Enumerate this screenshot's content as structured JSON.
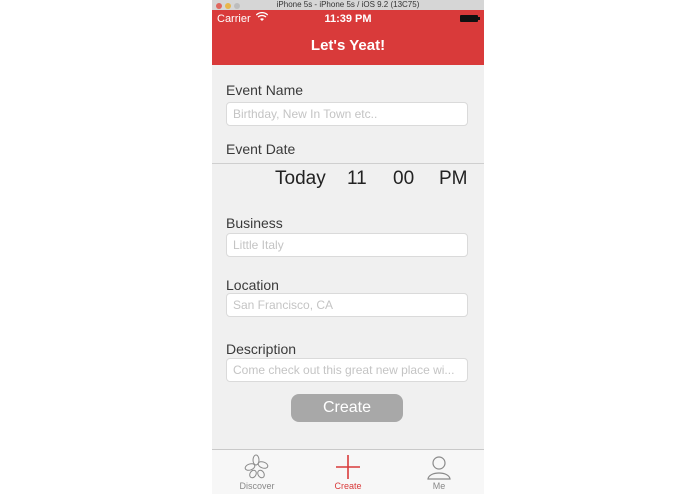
{
  "simulator": {
    "title": "iPhone 5s - iPhone 5s / iOS 9.2 (13C75)"
  },
  "status_bar": {
    "carrier": "Carrier",
    "time": "11:39 PM"
  },
  "nav": {
    "title": "Let's Yeat!"
  },
  "form": {
    "event_name": {
      "label": "Event Name",
      "placeholder": "Birthday, New In Town etc.."
    },
    "event_date": {
      "label": "Event Date",
      "picker": {
        "day": "Today",
        "hour": "11",
        "minute": "00",
        "ampm": "PM"
      }
    },
    "business": {
      "label": "Business",
      "placeholder": "Little Italy"
    },
    "location": {
      "label": "Location",
      "placeholder": "San Francisco, CA"
    },
    "description": {
      "label": "Description",
      "placeholder": "Come check out this great new place wi..."
    },
    "create_label": "Create"
  },
  "tabbar": {
    "items": [
      {
        "label": "Discover",
        "icon": "discover-icon",
        "color": "#8a8a8a"
      },
      {
        "label": "Create",
        "icon": "plus-icon",
        "color": "#d93a3a"
      },
      {
        "label": "Me",
        "icon": "person-icon",
        "color": "#8a8a8a"
      }
    ]
  },
  "colors": {
    "accent": "#d93a3a",
    "button_disabled": "#a8a8a8"
  }
}
